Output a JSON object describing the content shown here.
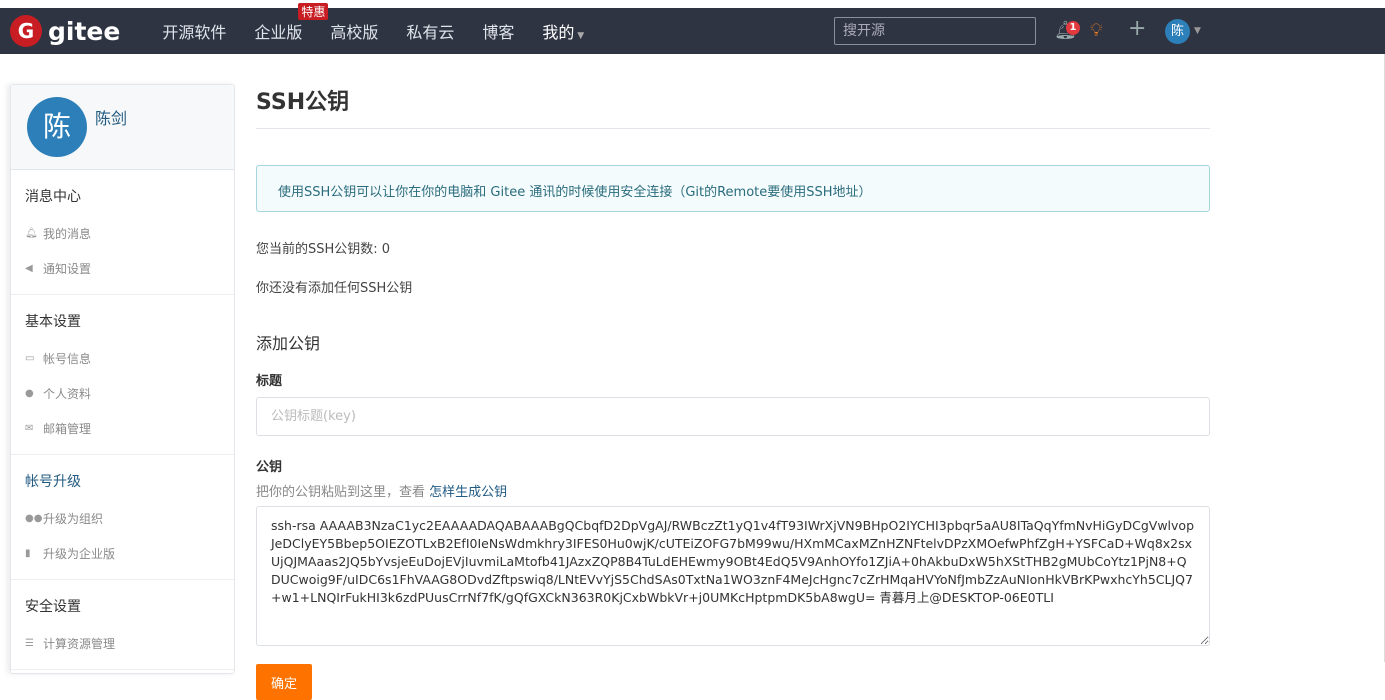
{
  "nav": {
    "logo_letter": "G",
    "logo_text": "gitee",
    "items": [
      "开源软件",
      "企业版",
      "高校版",
      "私有云",
      "博客"
    ],
    "hot_badge": "特惠",
    "mine": "我的",
    "search_placeholder": "搜开源",
    "notification_count": "1",
    "avatar_letter": "陈",
    "brand_color": "#c71d23",
    "nav_bg": "#2f3442"
  },
  "sidebar": {
    "avatar_letter": "陈",
    "username": "陈剑",
    "groups": [
      {
        "title": "消息中心",
        "items": [
          {
            "label": "我的消息",
            "icon": "bell-icon"
          },
          {
            "label": "通知设置",
            "icon": "volume-icon"
          }
        ]
      },
      {
        "title": "基本设置",
        "items": [
          {
            "label": "帐号信息",
            "icon": "id-card-icon"
          },
          {
            "label": "个人资料",
            "icon": "user-icon"
          },
          {
            "label": "邮箱管理",
            "icon": "envelope-icon"
          }
        ]
      },
      {
        "title": "帐号升级",
        "items": [
          {
            "label": "升级为组织",
            "icon": "users-icon"
          },
          {
            "label": "升级为企业版",
            "icon": "building-icon"
          }
        ]
      },
      {
        "title": "安全设置",
        "items": [
          {
            "label": "计算资源管理",
            "icon": "server-icon"
          }
        ]
      }
    ]
  },
  "main": {
    "title": "SSH公钥",
    "info": "使用SSH公钥可以让你在你的电脑和 Gitee 通讯的时候使用安全连接（Git的Remote要使用SSH地址）",
    "count_text": "您当前的SSH公钥数: 0",
    "empty_text": "你还没有添加任何SSH公钥",
    "add_title": "添加公钥",
    "title_label": "标题",
    "title_placeholder": "公钥标题(key)",
    "key_label": "公钥",
    "key_hint": "把你的公钥粘贴到这里，查看 ",
    "key_hint_link": "怎样生成公钥",
    "key_value": "ssh-rsa AAAAB3NzaC1yc2EAAAADAQABAAABgQCbqfD2DpVgAJ/RWBczZt1yQ1v4fT93IWrXjVN9BHpO2IYCHI3pbqr5aAU8ITaQqYfmNvHiGyDCgVwlvopJeDClyEY5Bbep5OIEZOTLxB2EfI0IeNsWdmkhry3IFES0Hu0wjK/cUTEiZOFG7bM99wu/HXmMCaxMZnHZNFtelvDPzXMOefwPhfZgH+YSFCaD+Wq8x2sxUjQJMAaas2JQ5bYvsjeEuDojEVjIuvmiLaMtofb41JAzxZQP8B4TuLdEHEwmy9OBt4EdQ5V9AnhOYfo1ZJiA+0hAkbuDxW5hXStTHB2gMUbCoYtz1PjN8+QDUCwoig9F/uIDC6s1FhVAAG8ODvdZftpswiq8/LNtEVvYjS5ChdSAs0TxtNa1WO3znF4MeJcHgnc7cZrHMqaHVYoNfJmbZzAuNIonHkVBrKPwxhcYh5CLJQ7+w1+LNQIrFukHI3k6zdPUusCrrNf7fK/gQfGXCkN363R0KjCxbWbkVr+j0UMKcHptpmDK5bA8wgU= 青暮月上@DESKTOP-06E0TLI",
    "submit": "确定",
    "accent": "#fe7300"
  }
}
